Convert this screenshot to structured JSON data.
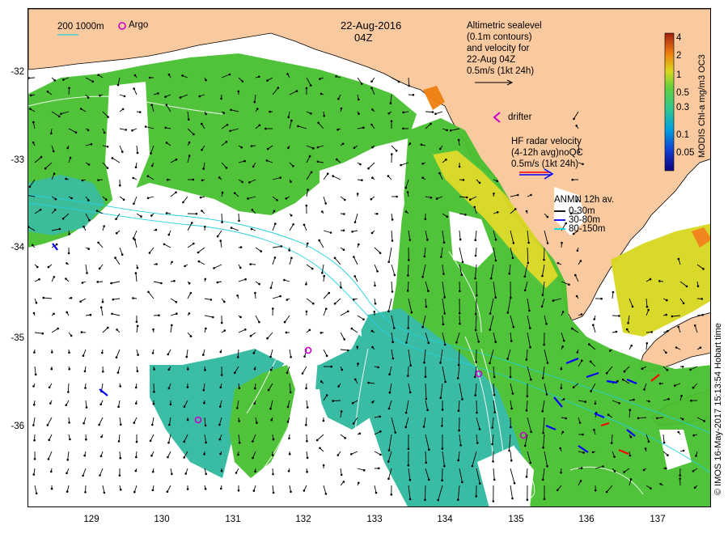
{
  "title": {
    "date": "22-Aug-2016",
    "time": "04Z"
  },
  "scale_bar": {
    "label": "200  1000m"
  },
  "argo_legend": {
    "label": "Argo",
    "color": "#cc00cc"
  },
  "altimetry_legend": {
    "lines": [
      "Altimetric sealevel",
      "(0.1m contours)",
      "and velocity for",
      "22-Aug 04Z",
      "0.5m/s (1kt 24h)"
    ]
  },
  "drifter_legend": {
    "label": "drifter",
    "color": "#cc00cc"
  },
  "hf_radar_legend": {
    "lines": [
      "HF radar velocity",
      "(4-12h avg)noQC",
      "0.5m/s (1kt 24h)"
    ],
    "colors": [
      "#ff0000",
      "#0000ff"
    ]
  },
  "anmn_legend": {
    "title": "ANMN 12h av.",
    "items": [
      {
        "label": "0-30m",
        "color": "#000000"
      },
      {
        "label": "30-80m",
        "color": "#0000ff"
      },
      {
        "label": "80-150m",
        "color": "#00e0e0"
      }
    ]
  },
  "colorbar": {
    "label": "MODIS Chl-a mg/m3 OC3",
    "ticks": [
      "4",
      "2",
      "1",
      "0.5",
      "0.3",
      "0.1",
      "0.05"
    ]
  },
  "credit": "© IMOS 16-May-2017 15:13:54 Hobart time",
  "axes": {
    "x_ticks": [
      "129",
      "130",
      "131",
      "132",
      "133",
      "134",
      "135",
      "136",
      "137"
    ],
    "y_ticks": [
      "-32",
      "-33",
      "-34",
      "-35",
      "-36"
    ]
  },
  "colors": {
    "land": "#f9c9a0",
    "chl_green": "#48c030",
    "chl_teal": "#30b8a0",
    "chl_yellow": "#d8d820",
    "chl_orange": "#f08010",
    "no_data": "#ffffff"
  }
}
